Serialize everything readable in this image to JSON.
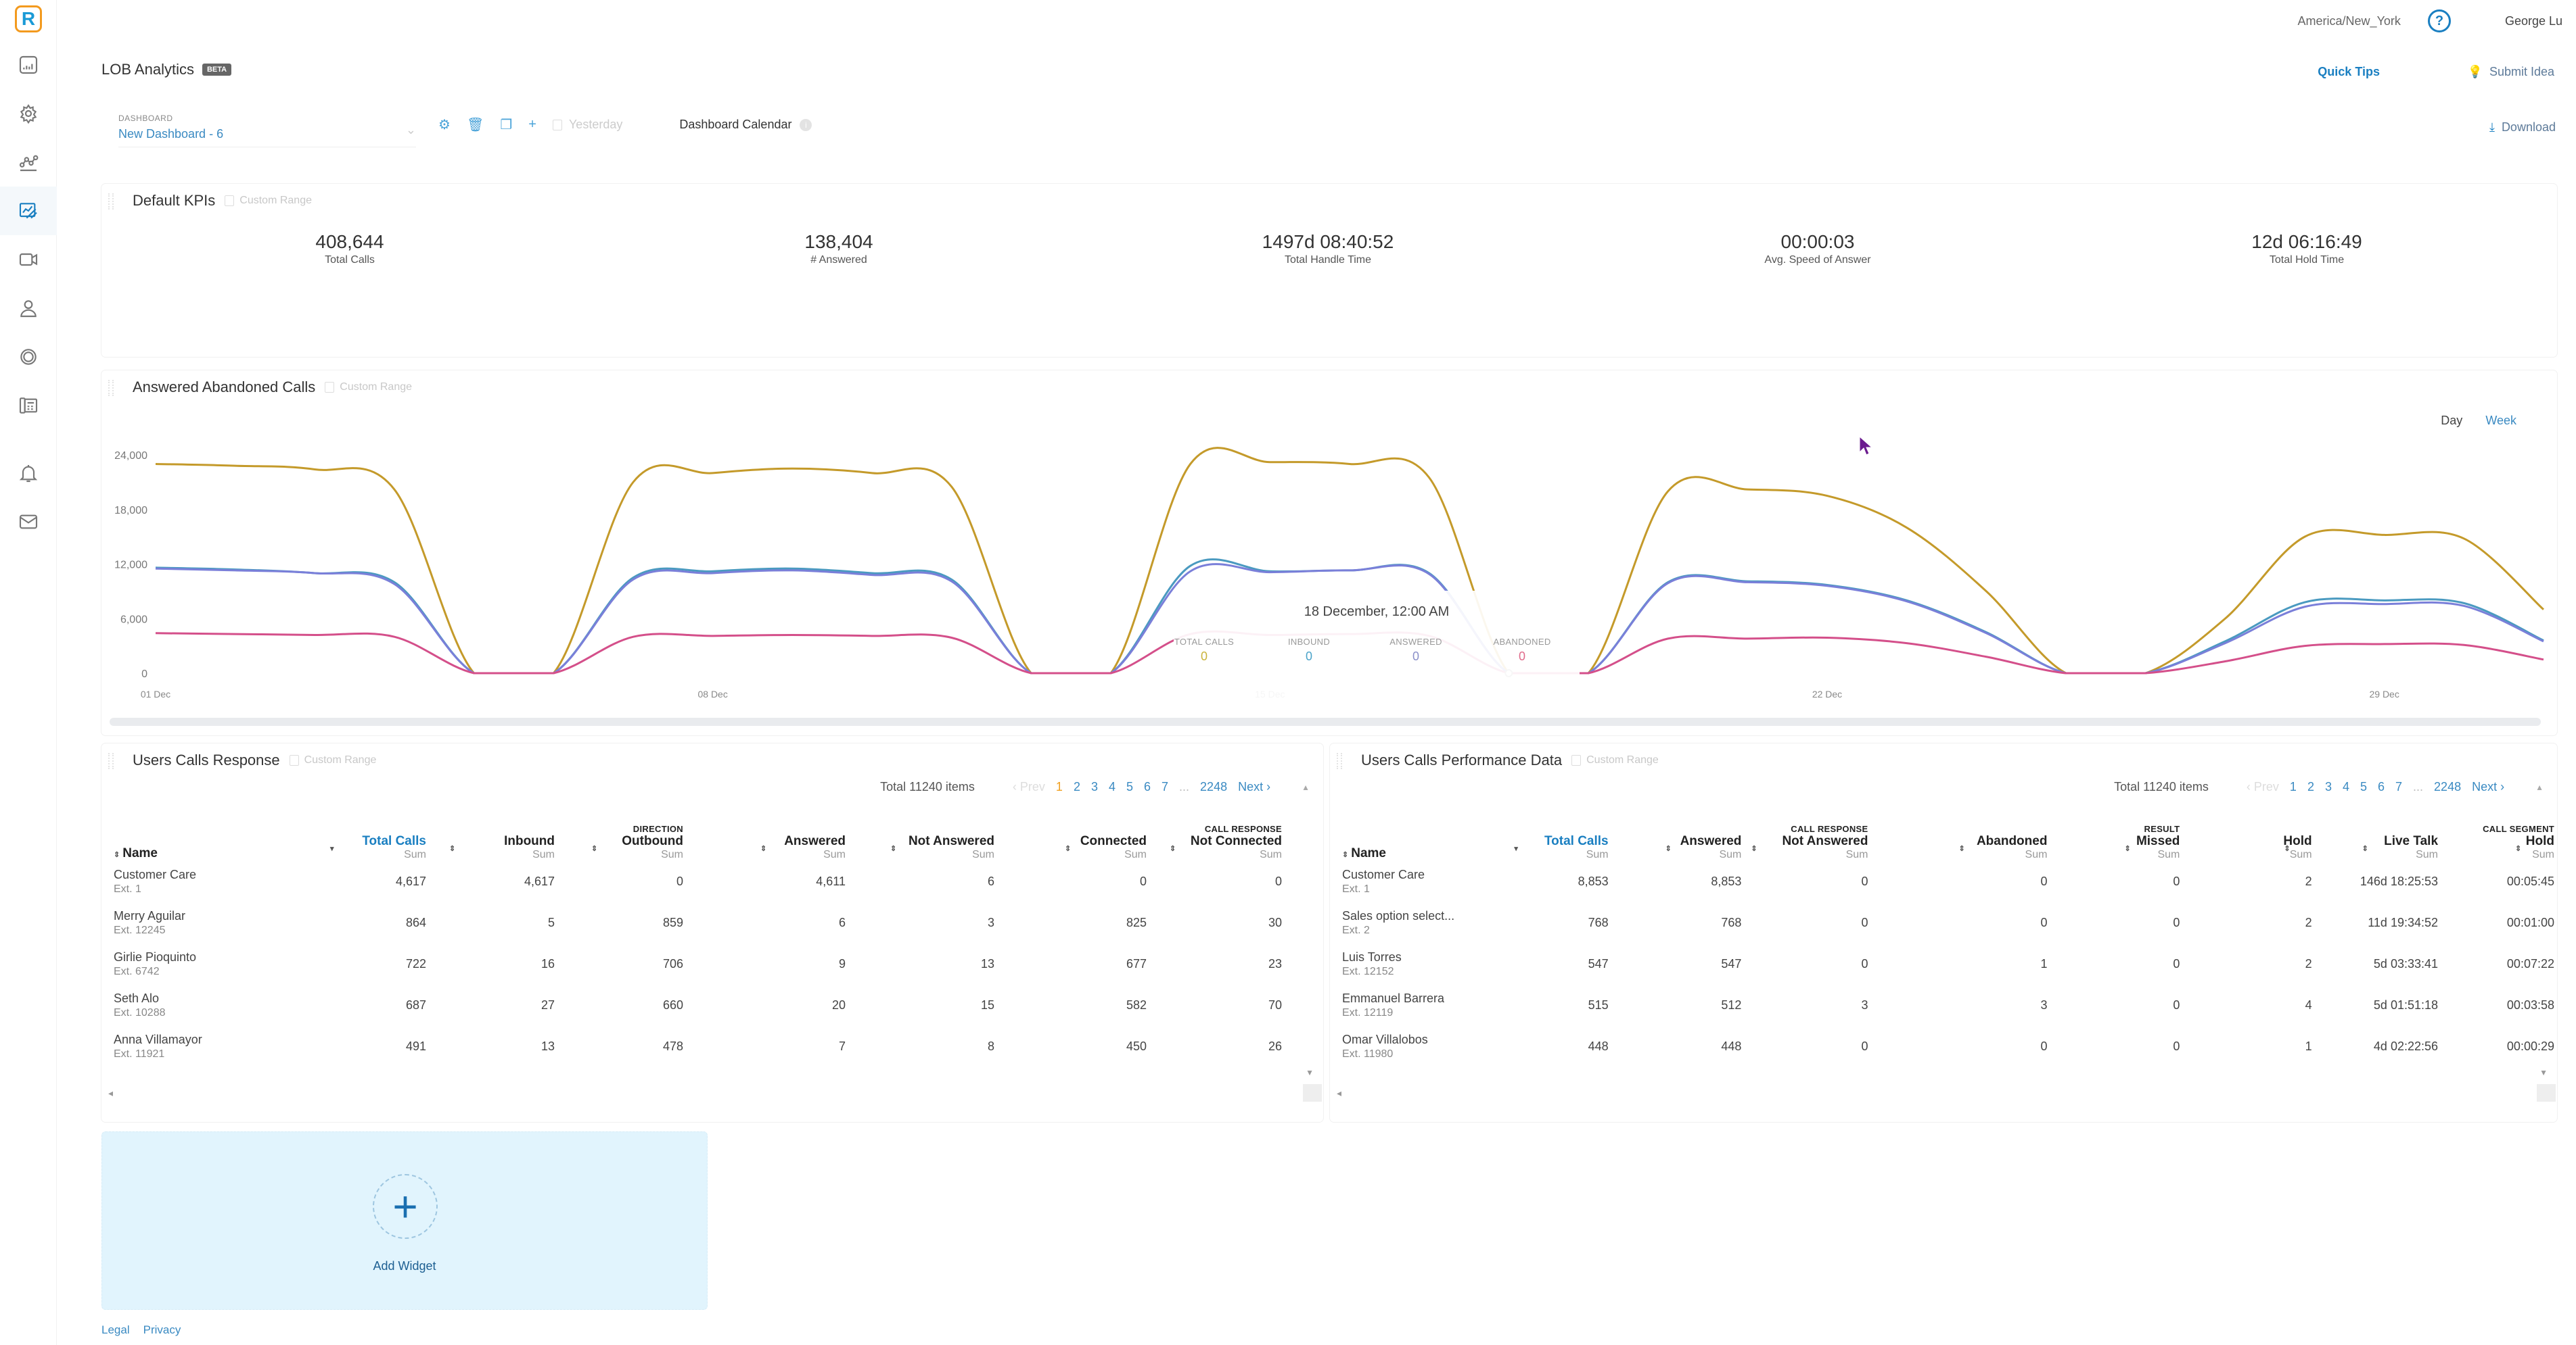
{
  "sidebar": {
    "logo": "R",
    "items": [
      {
        "name": "reports"
      },
      {
        "name": "integrations"
      },
      {
        "name": "analytics"
      },
      {
        "name": "lob-analytics",
        "active": true
      },
      {
        "name": "video"
      },
      {
        "name": "contacts"
      },
      {
        "name": "sync"
      },
      {
        "name": "phone"
      },
      {
        "name": "notifications"
      },
      {
        "name": "messages"
      }
    ]
  },
  "topbar": {
    "timezone": "America/New_York",
    "help_icon": "?",
    "user_name": "George Lu"
  },
  "header": {
    "title": "LOB Analytics",
    "badge": "BETA",
    "quick_tips": "Quick Tips",
    "submit_idea": "Submit Idea",
    "download": "Download"
  },
  "dashboard": {
    "label": "DASHBOARD",
    "value": "New Dashboard - 6",
    "date_filter": "Yesterday",
    "calendar_label": "Dashboard Calendar",
    "info_icon": "i"
  },
  "kpi_widget": {
    "title": "Default KPIs",
    "custom_range": "Custom Range",
    "kpis": [
      {
        "value": "408,644",
        "label": "Total Calls"
      },
      {
        "value": "138,404",
        "label": "# Answered"
      },
      {
        "value": "1497d 08:40:52",
        "label": "Total Handle Time"
      },
      {
        "value": "00:00:03",
        "label": "Avg. Speed of Answer"
      },
      {
        "value": "12d 06:16:49",
        "label": "Total Hold Time"
      }
    ]
  },
  "chart_widget": {
    "title": "Answered Abandoned Calls",
    "custom_range": "Custom Range",
    "toggle": {
      "day": "Day",
      "week": "Week",
      "selected": "Day"
    },
    "tooltip": {
      "title": "18 December, 12:00 AM",
      "items": [
        {
          "label": "TOTAL CALLS",
          "value": "0",
          "color": "#c9b33a"
        },
        {
          "label": "INBOUND",
          "value": "0",
          "color": "#4aa3c9"
        },
        {
          "label": "ANSWERED",
          "value": "0",
          "color": "#8a8fc9"
        },
        {
          "label": "ABANDONED",
          "value": "0",
          "color": "#e06a8a"
        }
      ]
    }
  },
  "chart_data": {
    "type": "line",
    "title": "Answered Abandoned Calls",
    "xlabel": "",
    "ylabel": "",
    "ylim": [
      0,
      24000
    ],
    "yticks": [
      "0",
      "6,000",
      "12,000",
      "18,000",
      "24,000"
    ],
    "ytick_values": [
      0,
      6000,
      12000,
      18000,
      24000
    ],
    "xlim": [
      1,
      31
    ],
    "xticks": [
      {
        "day": 1,
        "label": "01 Dec"
      },
      {
        "day": 8,
        "label": "08 Dec"
      },
      {
        "day": 15,
        "label": "15 Dec"
      },
      {
        "day": 22,
        "label": "22 Dec"
      },
      {
        "day": 29,
        "label": "29 Dec"
      }
    ],
    "x": [
      1,
      2,
      3,
      4,
      5,
      6,
      7,
      8,
      9,
      10,
      11,
      12,
      13,
      14,
      15,
      16,
      17,
      18,
      19,
      20,
      21,
      22,
      23,
      24,
      25,
      26,
      27,
      28,
      29,
      30,
      31
    ],
    "series": [
      {
        "name": "Total Calls",
        "color": "#c49a2a",
        "values": [
          23000,
          22800,
          22400,
          20200,
          0,
          0,
          21000,
          22000,
          22500,
          22000,
          20500,
          0,
          0,
          23000,
          23200,
          23000,
          21500,
          0,
          0,
          20000,
          20200,
          19500,
          16000,
          9000,
          0,
          0,
          6000,
          15000,
          15200,
          14800,
          7000
        ]
      },
      {
        "name": "Inbound",
        "color": "#4a9ac0",
        "values": [
          11600,
          11400,
          11000,
          10000,
          0,
          0,
          10500,
          11200,
          11500,
          11000,
          10300,
          0,
          0,
          11800,
          11200,
          11300,
          11000,
          0,
          0,
          10000,
          10100,
          9700,
          8000,
          4500,
          0,
          0,
          3500,
          7800,
          8000,
          7700,
          3600
        ]
      },
      {
        "name": "Answered",
        "color": "#7a7fd9",
        "values": [
          11500,
          11300,
          11000,
          9800,
          0,
          0,
          10300,
          11000,
          11300,
          10800,
          10100,
          0,
          0,
          11200,
          11100,
          11300,
          10900,
          0,
          0,
          9900,
          10000,
          9600,
          7900,
          4400,
          0,
          0,
          3300,
          7300,
          7600,
          7400,
          3500
        ]
      },
      {
        "name": "Abandoned",
        "color": "#d44f8a",
        "values": [
          4400,
          4300,
          4200,
          4000,
          0,
          0,
          4000,
          4100,
          4200,
          4100,
          3900,
          0,
          0,
          4300,
          4200,
          4300,
          4100,
          0,
          0,
          3800,
          3800,
          3900,
          3300,
          1800,
          0,
          0,
          1300,
          3000,
          3200,
          3100,
          1500
        ]
      }
    ],
    "legend": "none",
    "grid": false
  },
  "table_left": {
    "title": "Users Calls Response",
    "custom_range": "Custom Range",
    "total": "Total 11240 items",
    "pager": {
      "prev": "‹ Prev",
      "pages": [
        "1",
        "2",
        "3",
        "4",
        "5",
        "6",
        "7"
      ],
      "ellipsis": "...",
      "last": "2248",
      "next": "Next ›",
      "current": "1"
    },
    "groups": {
      "direction": "DIRECTION",
      "call_response": "CALL RESPONSE"
    },
    "columns": [
      {
        "label": "Name",
        "sub": ""
      },
      {
        "label": "Total Calls",
        "sub": "Sum"
      },
      {
        "label": "Inbound",
        "sub": "Sum"
      },
      {
        "label": "Outbound",
        "sub": "Sum"
      },
      {
        "label": "Answered",
        "sub": "Sum"
      },
      {
        "label": "Not Answered",
        "sub": "Sum"
      },
      {
        "label": "Connected",
        "sub": "Sum"
      },
      {
        "label": "Not Connected",
        "sub": "Sum"
      }
    ],
    "rows": [
      {
        "name": "Customer Care",
        "ext": "Ext. 1",
        "cells": [
          "4,617",
          "4,617",
          "0",
          "4,611",
          "6",
          "0",
          "0"
        ]
      },
      {
        "name": "Merry Aguilar",
        "ext": "Ext. 12245",
        "cells": [
          "864",
          "5",
          "859",
          "6",
          "3",
          "825",
          "30"
        ]
      },
      {
        "name": "Girlie Pioquinto",
        "ext": "Ext. 6742",
        "cells": [
          "722",
          "16",
          "706",
          "9",
          "13",
          "677",
          "23"
        ]
      },
      {
        "name": "Seth Alo",
        "ext": "Ext. 10288",
        "cells": [
          "687",
          "27",
          "660",
          "20",
          "15",
          "582",
          "70"
        ]
      },
      {
        "name": "Anna Villamayor",
        "ext": "Ext. 11921",
        "cells": [
          "491",
          "13",
          "478",
          "7",
          "8",
          "450",
          "26"
        ]
      }
    ]
  },
  "table_right": {
    "title": "Users Calls Performance Data",
    "custom_range": "Custom Range",
    "total": "Total 11240 items",
    "pager": {
      "prev": "‹ Prev",
      "pages": [
        "1",
        "2",
        "3",
        "4",
        "5",
        "6",
        "7"
      ],
      "ellipsis": "...",
      "last": "2248",
      "next": "Next ›",
      "current": "1"
    },
    "groups": {
      "call_response": "CALL RESPONSE",
      "result": "RESULT",
      "call_segment": "CALL SEGMENT"
    },
    "columns": [
      {
        "label": "Name",
        "sub": ""
      },
      {
        "label": "Total Calls",
        "sub": "Sum"
      },
      {
        "label": "Answered",
        "sub": "Sum"
      },
      {
        "label": "Not Answered",
        "sub": "Sum"
      },
      {
        "label": "Abandoned",
        "sub": "Sum"
      },
      {
        "label": "Missed",
        "sub": "Sum"
      },
      {
        "label": "Hold",
        "sub": "Sum"
      },
      {
        "label": "Live Talk",
        "sub": "Sum"
      },
      {
        "label": "Hold",
        "sub": "Sum"
      }
    ],
    "rows": [
      {
        "name": "Customer Care",
        "ext": "Ext. 1",
        "cells": [
          "8,853",
          "8,853",
          "0",
          "0",
          "0",
          "2",
          "146d 18:25:53",
          "00:05:45"
        ]
      },
      {
        "name": "Sales option select...",
        "ext": "Ext. 2",
        "cells": [
          "768",
          "768",
          "0",
          "0",
          "0",
          "2",
          "11d 19:34:52",
          "00:01:00"
        ]
      },
      {
        "name": "Luis Torres",
        "ext": "Ext. 12152",
        "cells": [
          "547",
          "547",
          "0",
          "1",
          "0",
          "2",
          "5d 03:33:41",
          "00:07:22"
        ]
      },
      {
        "name": "Emmanuel Barrera",
        "ext": "Ext. 12119",
        "cells": [
          "515",
          "512",
          "3",
          "3",
          "0",
          "4",
          "5d 01:51:18",
          "00:03:58"
        ]
      },
      {
        "name": "Omar Villalobos",
        "ext": "Ext. 11980",
        "cells": [
          "448",
          "448",
          "0",
          "0",
          "0",
          "1",
          "4d 02:22:56",
          "00:00:29"
        ]
      }
    ]
  },
  "add_widget": {
    "label": "Add Widget",
    "icon": "+"
  },
  "footer": {
    "legal": "Legal",
    "privacy": "Privacy"
  }
}
